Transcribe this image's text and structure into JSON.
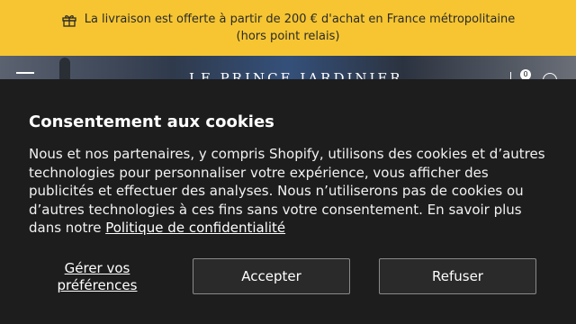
{
  "promo": {
    "line1": "La livraison est offerte à partir de 200 € d'achat en France métropolitaine",
    "line2": "(hors point relais)",
    "icon": "gift-icon"
  },
  "header": {
    "logo": "LE PRINCE JARDINIER",
    "cart_count": "0",
    "icons": [
      "menu-icon",
      "cart-icon",
      "search-icon"
    ]
  },
  "cookie": {
    "title": "Consentement aux cookies",
    "body": "Nous et nos partenaires, y compris Shopify, utilisons des cookies et d’autres technologies pour personnaliser votre expérience, vous afficher des publicités et effectuer des analyses. Nous n’utiliserons pas de cookies ou d’autres technologies à ces fins sans votre consentement. En savoir plus dans notre ",
    "privacy_link": "Politique de confidentialité",
    "prefs_label": "Gérer vos préférences",
    "accept_label": "Accepter",
    "refuse_label": "Refuser"
  },
  "colors": {
    "promo_bg": "#f6c531",
    "panel_bg": "#1d1d1d"
  }
}
